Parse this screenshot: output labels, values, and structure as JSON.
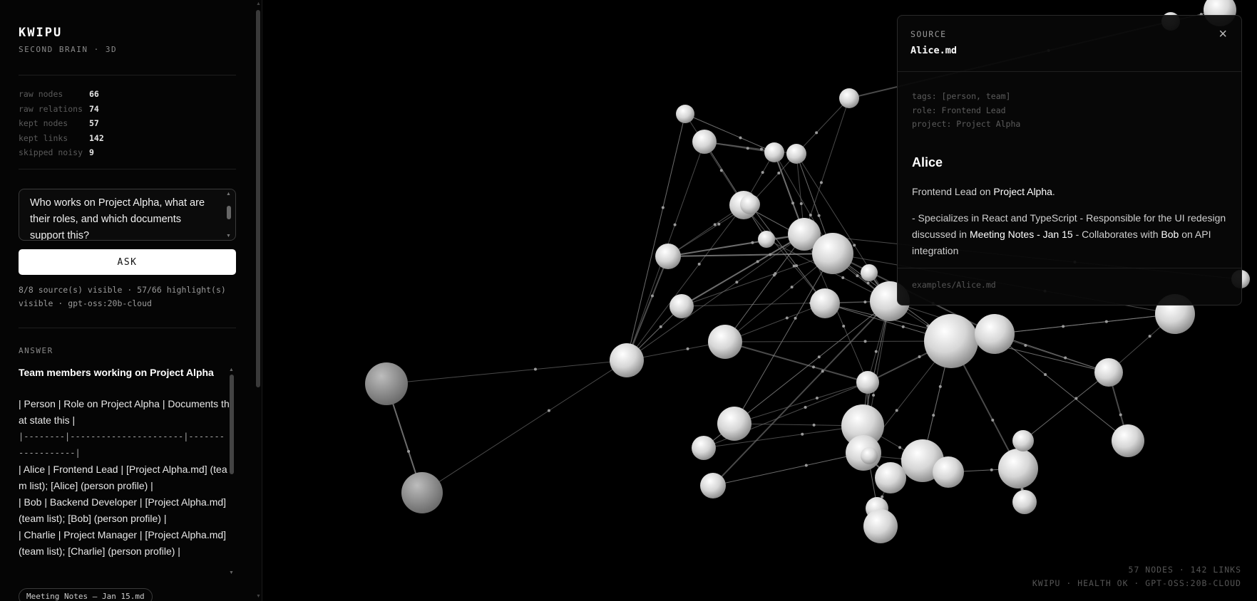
{
  "brand": {
    "title": "KWIPU",
    "subtitle": "SECOND BRAIN · 3D"
  },
  "stats": [
    {
      "label": "raw nodes",
      "value": "66"
    },
    {
      "label": "raw relations",
      "value": "74"
    },
    {
      "label": "kept nodes",
      "value": "57"
    },
    {
      "label": "kept links",
      "value": "142"
    },
    {
      "label": "skipped noisy",
      "value": "9"
    }
  ],
  "query": {
    "text": "Who works on Project Alpha, what are their roles, and which documents support this?"
  },
  "ask_label": "ASK",
  "status": "8/8 source(s) visible · 57/66 highlight(s) visible · gpt-oss:20b-cloud",
  "answer": {
    "label": "ANSWER",
    "title": "Team members working on Project Alpha",
    "lines": [
      "| Person | Role on Project Alpha | Documents that state this |",
      "|--------|----------------------|------------------|",
      "| Alice | Frontend Lead | [Project Alpha.md] (team list); [Alice] (person profile) |",
      "| Bob | Backend Developer | [Project Alpha.md] (team list); [Bob] (person profile) |",
      "| Charlie | Project Manager | [Project Alpha.md] (team list); [Charlie] (person profile) |"
    ]
  },
  "source_chip": "Meeting Notes – Jan 15.md",
  "footer": {
    "counts": "57 NODES · 142 LINKS",
    "status": "KWIPU · HEALTH OK · GPT-OSS:20B-CLOUD"
  },
  "panel": {
    "label": "SOURCE",
    "file": "Alice.md",
    "close": "×",
    "frontmatter": [
      "tags: [person, team]",
      "role: Frontend Lead",
      "project: Project Alpha"
    ],
    "heading": "Alice",
    "para1": {
      "before": "Frontend Lead on ",
      "link": "Project Alpha",
      "after": "."
    },
    "para2": {
      "a": "- Specializes in React and TypeScript - Responsible for the UI redesign discussed in ",
      "link1": "Meeting Notes - Jan 15",
      "b": " - Collaborates with ",
      "link2": "Bob",
      "c": " on API integration"
    },
    "path": "examples/Alice.md"
  },
  "colors": {
    "background": "#000000",
    "node": "#e6e6e6",
    "edge": "#8a8a8a",
    "accent": "#ffffff"
  }
}
